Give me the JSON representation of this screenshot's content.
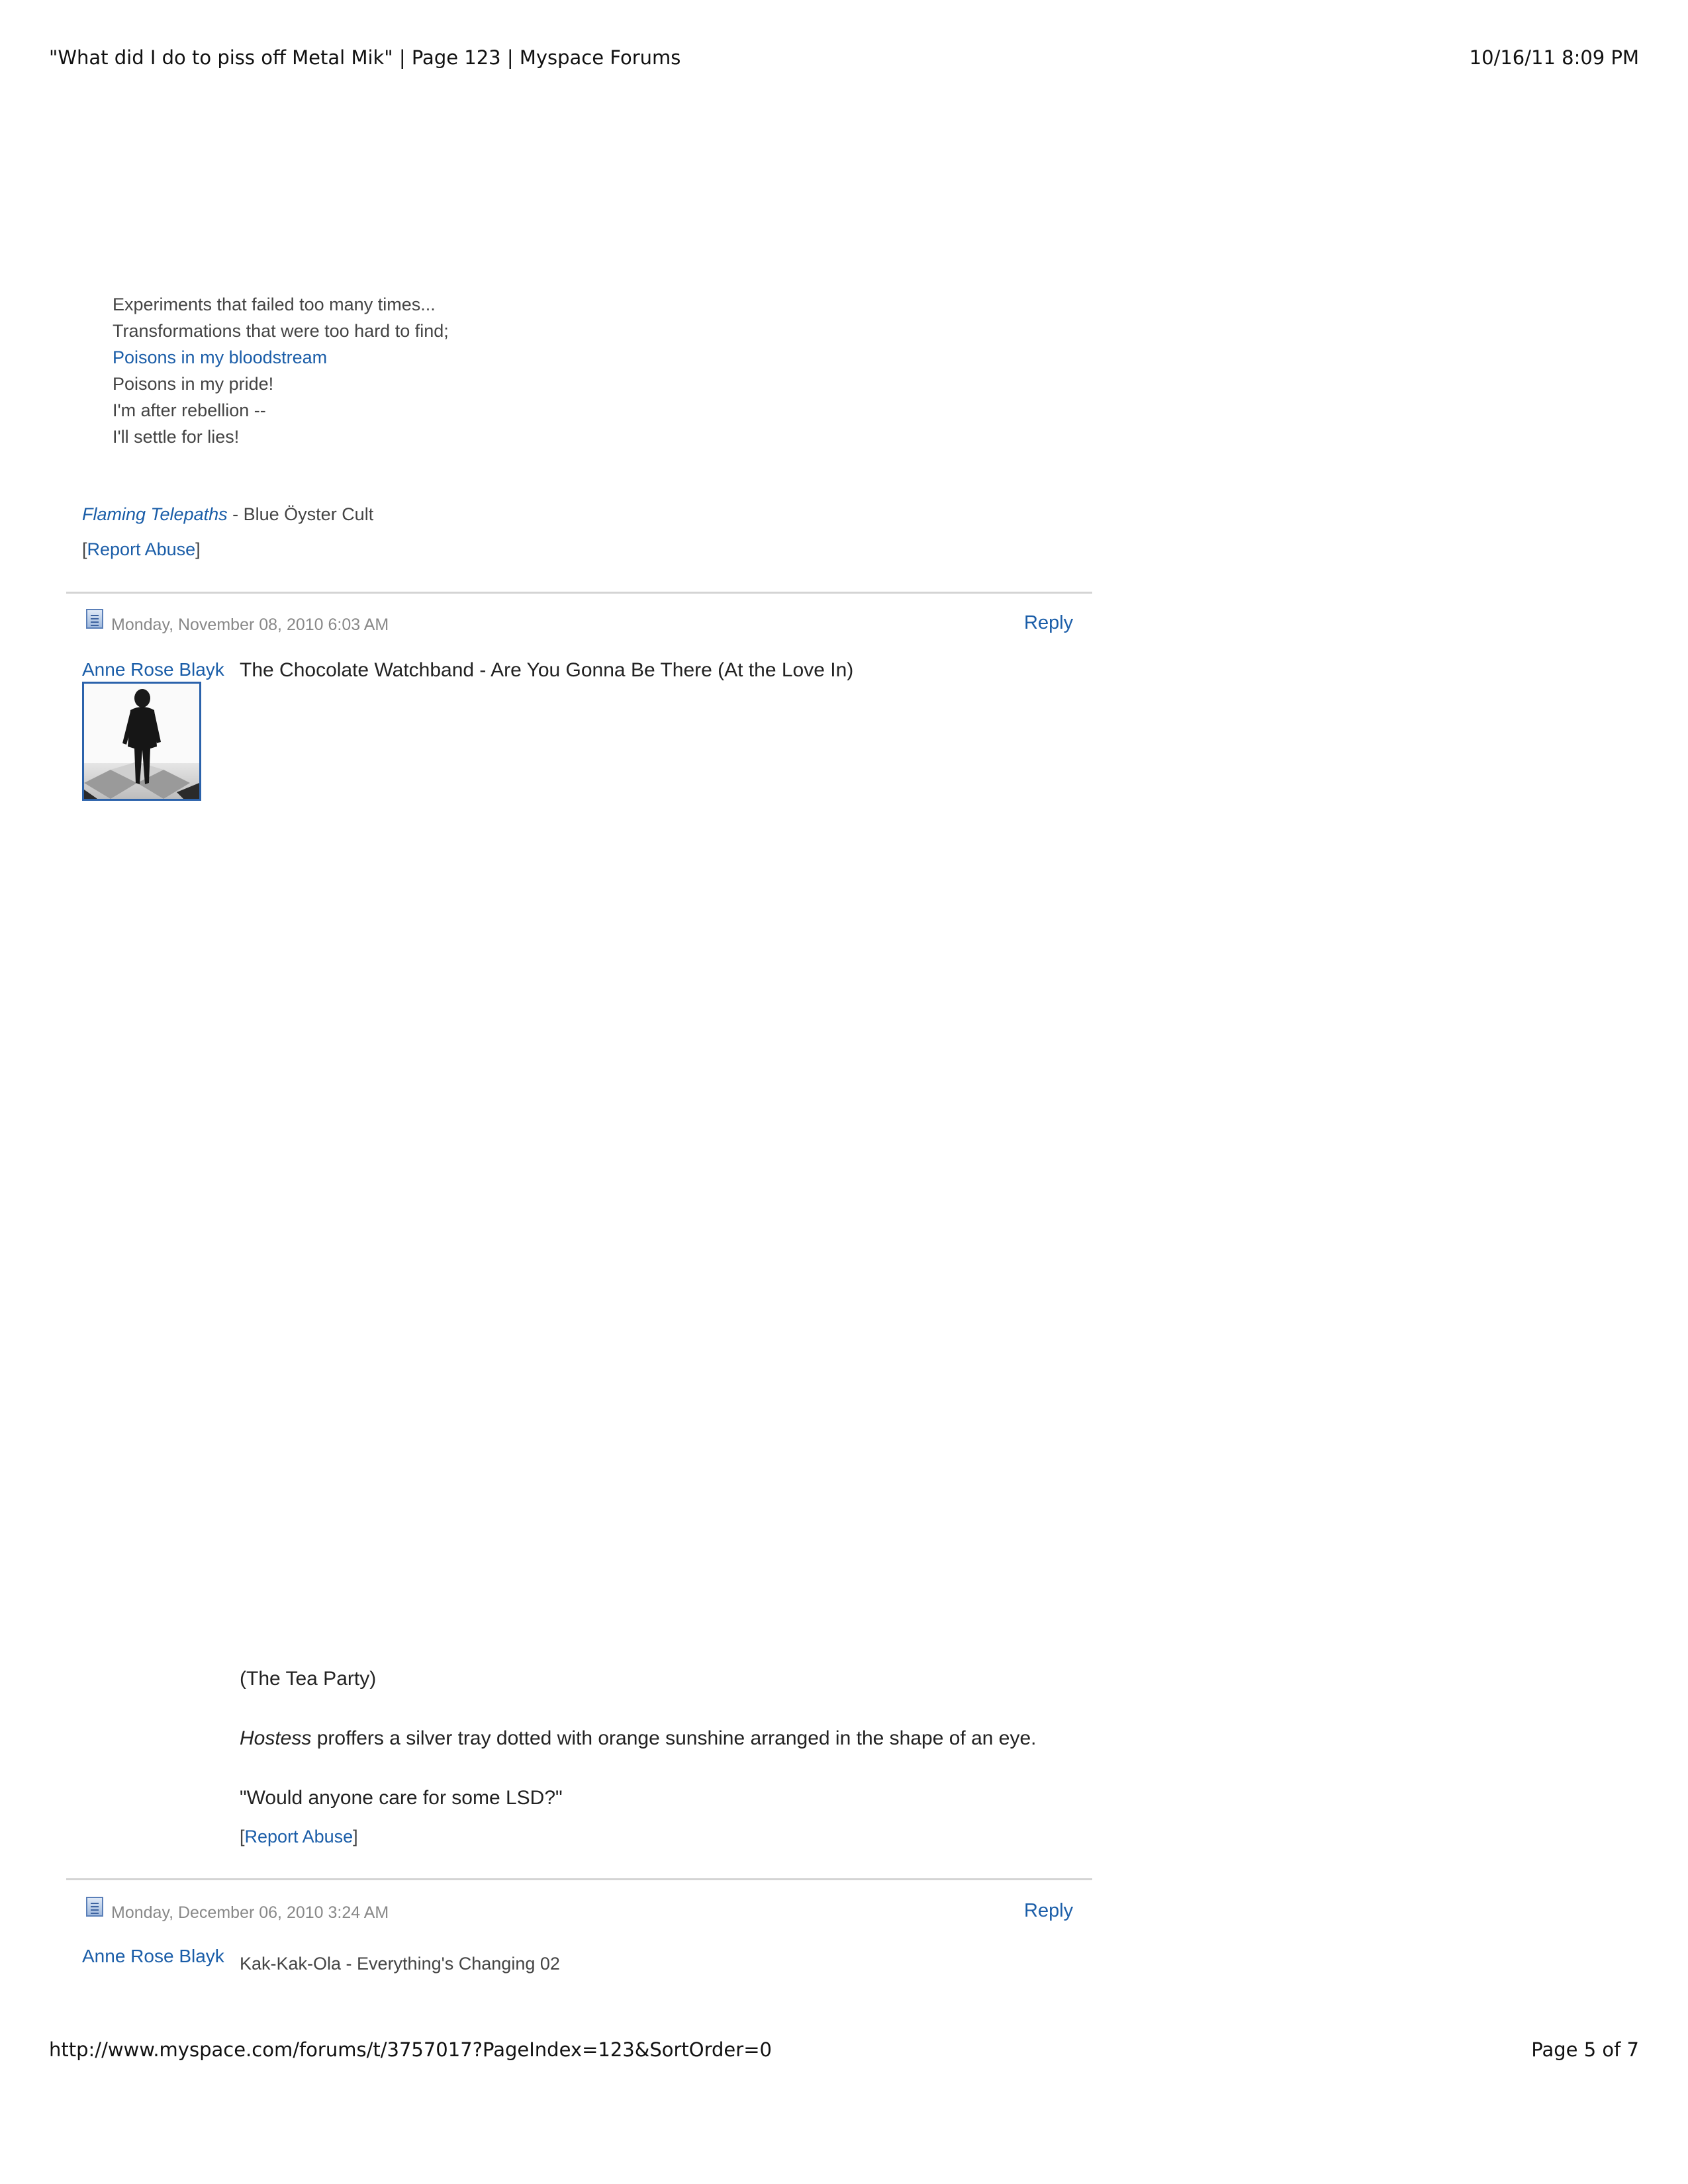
{
  "print_header": {
    "title": "\"What did I do to piss off Metal Mik\" | Page 123 | Myspace Forums",
    "datetime": "10/16/11 8:09 PM"
  },
  "print_footer": {
    "url": "http://www.myspace.com/forums/t/3757017?PageIndex=123&SortOrder=0",
    "page": "Page 5 of 7"
  },
  "post1": {
    "lyrics": [
      "Experiments that failed too many times...",
      "Transformations that were too hard to find;",
      "Poisons in my bloodstream",
      "Poisons in my pride!",
      "I'm after rebellion --",
      "I'll settle for lies!"
    ],
    "song_link": "Flaming Telepaths",
    "song_artist": " - Blue Öyster Cult",
    "report_open": "[",
    "report_label": "Report Abuse",
    "report_close": "]"
  },
  "post2": {
    "date": "Monday, November 08, 2010 6:03 AM",
    "reply_label": "Reply",
    "author": "Anne Rose Blayk",
    "title": "The Chocolate Watchband - Are You Gonna Be There (At the Love In)",
    "para1": "(The Tea Party)",
    "para2_em": "Hostess",
    "para2_rest": " proffers a silver tray dotted with orange sunshine arranged in the shape of an eye.",
    "para3": "\"Would anyone care for some LSD?\"",
    "report_open": "[",
    "report_label": "Report Abuse",
    "report_close": "]"
  },
  "post3": {
    "date": "Monday, December 06, 2010 3:24 AM",
    "reply_label": "Reply",
    "author": "Anne Rose Blayk",
    "title": "Kak-Kak-Ola - Everything's Changing 02"
  },
  "icons": {
    "post_icon": "document-icon",
    "avatar": "avatar-image"
  },
  "colors": {
    "link": "#1a5da8",
    "divider": "#d4d4d4",
    "date": "#888888"
  }
}
